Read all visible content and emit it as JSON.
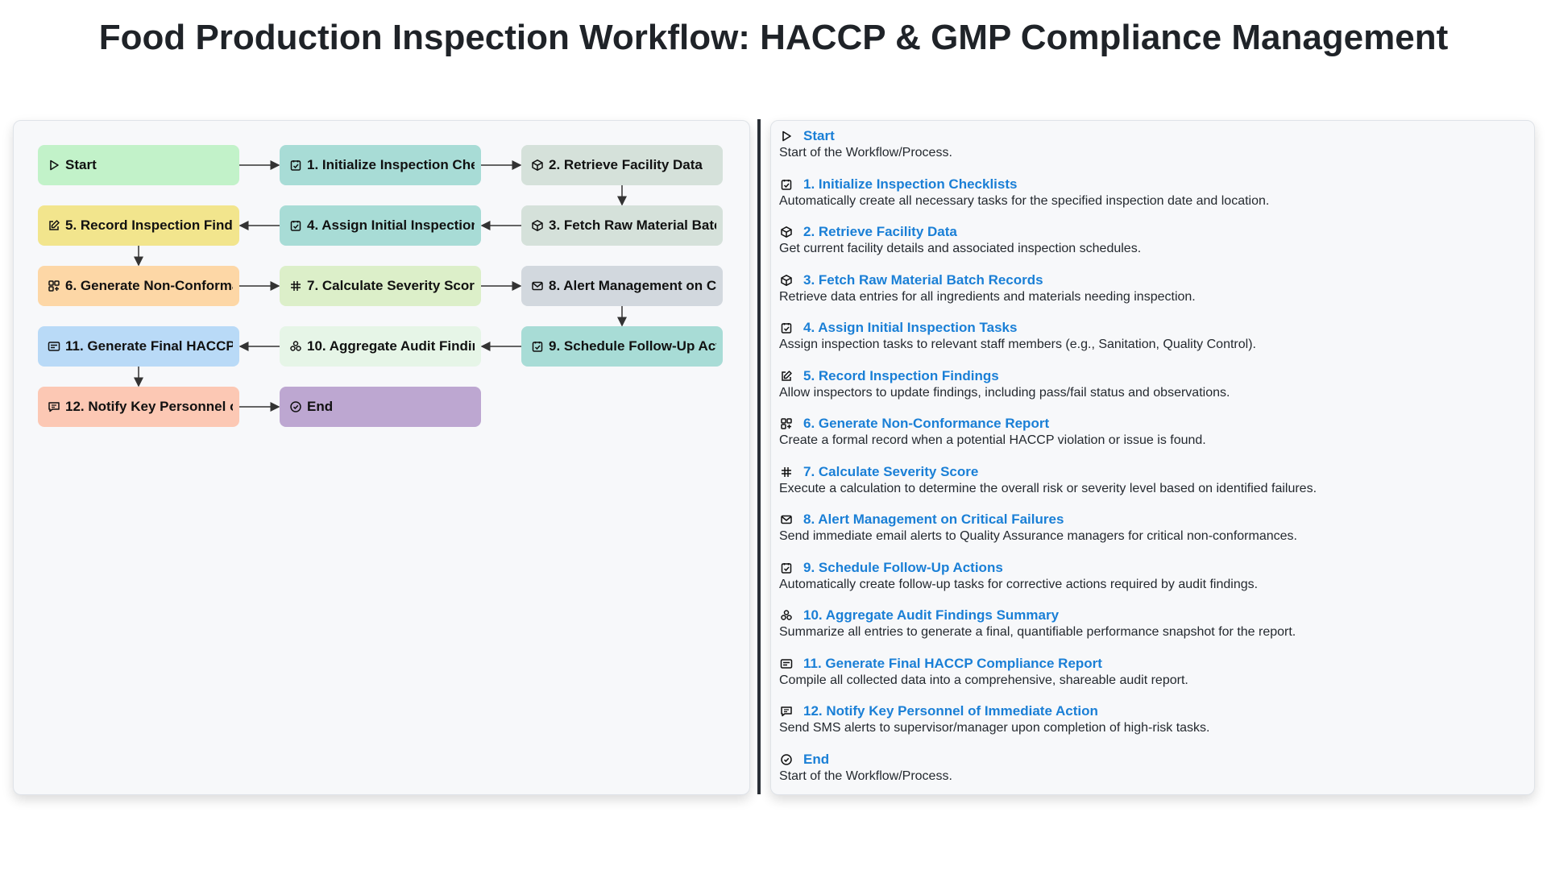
{
  "title": "Food Production Inspection Workflow: HACCP & GMP Compliance Management",
  "colors": {
    "start": "#c2f2c9",
    "teal": "#a8dcd6",
    "gray_green": "#d5e1da",
    "yellow": "#f2e58d",
    "orange": "#fdd7a6",
    "lime": "#dcefc9",
    "slate": "#d2d8de",
    "blue": "#b9daf7",
    "mint": "#e6f5e7",
    "salmon": "#fcc8b4",
    "purple": "#bda7d1",
    "link": "#1a7fd6"
  },
  "nodes": [
    {
      "label": "Start",
      "icon": "play-icon"
    },
    {
      "label": "1. Initialize Inspection Checklists",
      "icon": "checkbox-icon"
    },
    {
      "label": "2. Retrieve Facility Data",
      "icon": "cube-icon"
    },
    {
      "label": "3. Fetch Raw Material Batch Records",
      "icon": "cube-icon"
    },
    {
      "label": "4. Assign Initial Inspection Tasks",
      "icon": "checkbox-icon"
    },
    {
      "label": "5. Record Inspection Findings",
      "icon": "edit-icon"
    },
    {
      "label": "6. Generate Non-Conformance Report",
      "icon": "grid-plus-icon"
    },
    {
      "label": "7. Calculate Severity Score",
      "icon": "hash-icon"
    },
    {
      "label": "8. Alert Management on Critical Failures",
      "icon": "mail-icon"
    },
    {
      "label": "9. Schedule Follow-Up Actions",
      "icon": "checkbox-icon"
    },
    {
      "label": "10. Aggregate Audit Findings Summary",
      "icon": "aggregate-icon"
    },
    {
      "label": "11. Generate Final HACCP Compliance Report",
      "icon": "report-icon"
    },
    {
      "label": "12. Notify Key Personnel of Immediate Action",
      "icon": "message-icon"
    },
    {
      "label": "End",
      "icon": "check-circle-icon"
    }
  ],
  "details": [
    {
      "title": "Start",
      "desc": "Start of the Workflow/Process."
    },
    {
      "title": "1. Initialize Inspection Checklists",
      "desc": "Automatically create all necessary tasks for the specified inspection date and location."
    },
    {
      "title": "2. Retrieve Facility Data",
      "desc": "Get current facility details and associated inspection schedules."
    },
    {
      "title": "3. Fetch Raw Material Batch Records",
      "desc": "Retrieve data entries for all ingredients and materials needing inspection."
    },
    {
      "title": "4. Assign Initial Inspection Tasks",
      "desc": "Assign inspection tasks to relevant staff members (e.g., Sanitation, Quality Control)."
    },
    {
      "title": "5. Record Inspection Findings",
      "desc": "Allow inspectors to update findings, including pass/fail status and observations."
    },
    {
      "title": "6. Generate Non-Conformance Report",
      "desc": "Create a formal record when a potential HACCP violation or issue is found."
    },
    {
      "title": "7. Calculate Severity Score",
      "desc": "Execute a calculation to determine the overall risk or severity level based on identified failures."
    },
    {
      "title": "8. Alert Management on Critical Failures",
      "desc": "Send immediate email alerts to Quality Assurance managers for critical non-conformances."
    },
    {
      "title": "9. Schedule Follow-Up Actions",
      "desc": "Automatically create follow-up tasks for corrective actions required by audit findings."
    },
    {
      "title": "10. Aggregate Audit Findings Summary",
      "desc": "Summarize all entries to generate a final, quantifiable performance snapshot for the report."
    },
    {
      "title": "11. Generate Final HACCP Compliance Report",
      "desc": "Compile all collected data into a comprehensive, shareable audit report."
    },
    {
      "title": "12. Notify Key Personnel of Immediate Action",
      "desc": "Send SMS alerts to supervisor/manager upon completion of high-risk tasks."
    },
    {
      "title": "End",
      "desc": "Start of the Workflow/Process."
    }
  ]
}
